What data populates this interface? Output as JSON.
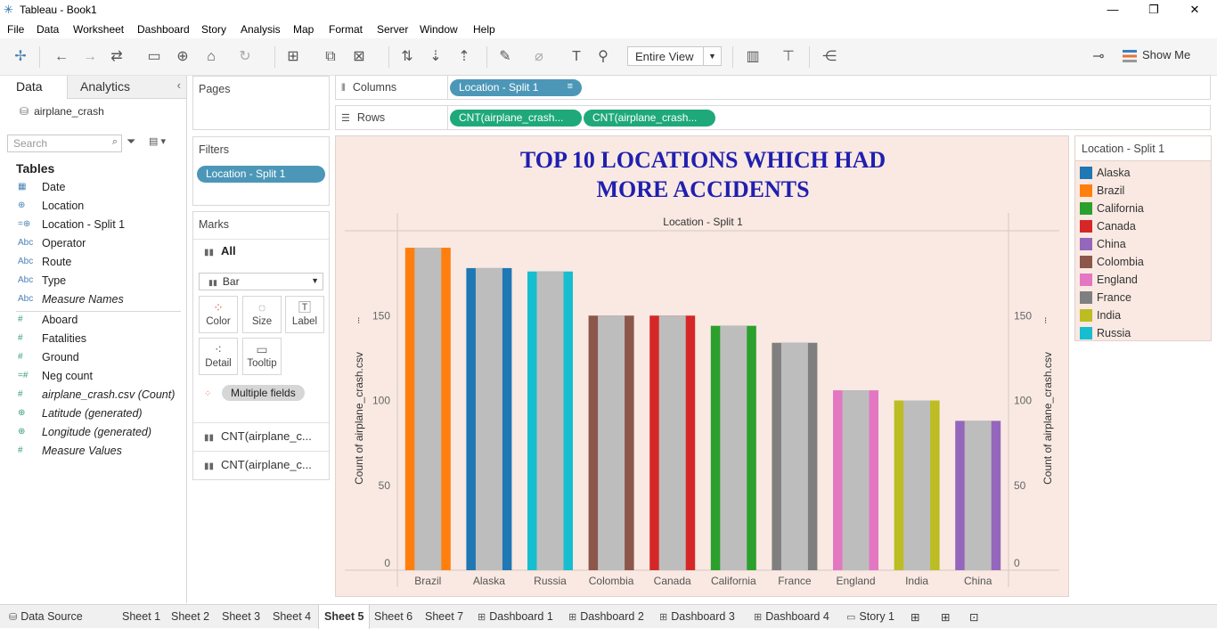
{
  "window": {
    "title": "Tableau - Book1"
  },
  "menu": [
    "File",
    "Data",
    "Worksheet",
    "Dashboard",
    "Story",
    "Analysis",
    "Map",
    "Format",
    "Server",
    "Window",
    "Help"
  ],
  "toolbar": {
    "fit_value": "Entire View",
    "show_me_label": "Show Me"
  },
  "left_pane": {
    "tab_data": "Data",
    "tab_analytics": "Analytics",
    "datasource": "airplane_crash",
    "search_placeholder": "Search",
    "tables_heading": "Tables",
    "fields": [
      {
        "icon": "calendar-icon",
        "label": "Date"
      },
      {
        "icon": "globe-icon",
        "label": "Location"
      },
      {
        "icon": "globe-icon",
        "label": "Location - Split 1"
      },
      {
        "icon": "Abc",
        "label": "Operator"
      },
      {
        "icon": "Abc",
        "label": "Route"
      },
      {
        "icon": "Abc",
        "label": "Type"
      },
      {
        "icon": "Abc",
        "label": "Measure Names"
      },
      {
        "icon": "#",
        "label": "Aboard"
      },
      {
        "icon": "#",
        "label": "Fatalities"
      },
      {
        "icon": "#",
        "label": "Ground"
      },
      {
        "icon": "=#",
        "label": "Neg count"
      },
      {
        "icon": "#",
        "label": "airplane_crash.csv (Count)"
      },
      {
        "icon": "globe-icon",
        "label": "Latitude (generated)"
      },
      {
        "icon": "globe-icon",
        "label": "Longitude (generated)"
      },
      {
        "icon": "#",
        "label": "Measure Values"
      }
    ]
  },
  "cards": {
    "pages": "Pages",
    "filters": "Filters",
    "filter_pill": "Location - Split 1",
    "marks": "Marks",
    "marks_all": "All",
    "mark_type": "Bar",
    "buttons": {
      "color": "Color",
      "size": "Size",
      "label": "Label",
      "detail": "Detail",
      "tooltip": "Tooltip"
    },
    "multiple_fields": "Multiple fields",
    "measure_rows": [
      "CNT(airplane_c...",
      "CNT(airplane_c..."
    ]
  },
  "shelves": {
    "columns_label": "Columns",
    "columns_pill": "Location - Split 1",
    "rows_label": "Rows",
    "rows_pills": [
      "CNT(airplane_crash...",
      "CNT(airplane_crash..."
    ]
  },
  "colors": {
    "Alaska": "#1f77b4",
    "Brazil": "#ff7f0e",
    "California": "#2ca02c",
    "Canada": "#d62728",
    "China": "#9467bd",
    "Colombia": "#8c564b",
    "England": "#e377c2",
    "France": "#7f7f7f",
    "India": "#bcbd22",
    "Russia": "#17becf",
    "secondary_bar": "#bdbdbd",
    "background": "#f9e9e2",
    "title": "#1f1fb0"
  },
  "chart_data": {
    "type": "bar",
    "title": "TOP 10 LOCATIONS WHICH HAD MORE ACCIDENTS",
    "header": "Location - Split 1",
    "categories": [
      "Brazil",
      "Alaska",
      "Russia",
      "Colombia",
      "Canada",
      "California",
      "France",
      "England",
      "India",
      "China"
    ],
    "series": [
      {
        "values": [
          190,
          178,
          176,
          150,
          150,
          144,
          134,
          106,
          100,
          88
        ]
      },
      {
        "values": [
          190,
          178,
          176,
          150,
          150,
          144,
          134,
          106,
          100,
          88
        ]
      }
    ],
    "ylabel": "Count of airplane_crash.csv",
    "y2label": "Count of airplane_crash.csv",
    "yticks": [
      0,
      50,
      100,
      150
    ],
    "ylim": [
      0,
      200
    ],
    "grid": false,
    "legend": {
      "title": "Location - Split 1",
      "position": "right",
      "entries": [
        "Alaska",
        "Brazil",
        "California",
        "Canada",
        "China",
        "Colombia",
        "England",
        "France",
        "India",
        "Russia"
      ]
    }
  },
  "sheet_tabs": [
    "Data Source",
    "Sheet 1",
    "Sheet 2",
    "Sheet 3",
    "Sheet 4",
    "Sheet 5",
    "Sheet 6",
    "Sheet 7",
    "Dashboard 1",
    "Dashboard 2",
    "Dashboard 3",
    "Dashboard 4",
    "Story 1"
  ],
  "active_tab": "Sheet 5"
}
